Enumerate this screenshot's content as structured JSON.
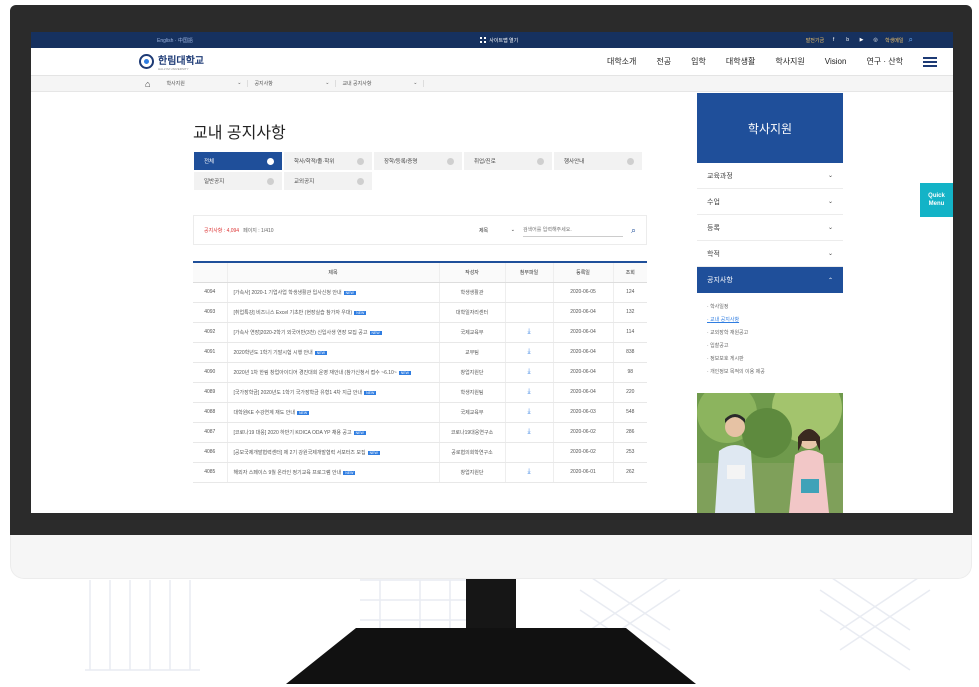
{
  "topbar": {
    "lang": "English · 中国語",
    "sitemap": "사이트맵 열기",
    "quick_label": "발전기금",
    "sns": [
      "f",
      "b",
      "▶",
      "◎"
    ],
    "student_link": "학생메일"
  },
  "header": {
    "logo": "한림대학교",
    "logo_sub": "HALLYM UNIVERSITY",
    "nav": [
      "대학소개",
      "전공",
      "입학",
      "대학생활",
      "학사지원",
      "Vision",
      "연구 · 산학"
    ]
  },
  "breadcrumb": [
    "학사지원",
    "공지사항",
    "교내 공지사항"
  ],
  "page_title": "교내 공지사항",
  "categories": [
    "전체",
    "학사/학적/졸·학위",
    "장학/등록/증명",
    "취업/진로",
    "행사안내",
    "일반공지",
    "교외공지"
  ],
  "search": {
    "count_label": "공지사항 : 4,094",
    "page_label": "페이지 : 1/410",
    "field": "제목",
    "placeholder": "검색어를 입력해주세요."
  },
  "table": {
    "headers": [
      "",
      "제목",
      "작성자",
      "첨부파일",
      "등록일",
      "조회"
    ],
    "new_badge": "NEW",
    "rows": [
      {
        "no": "4094",
        "title": "[가속사] 2020-1 기업사업 학생생활관 입사신청 안내",
        "author": "학생생활관",
        "file": false,
        "date": "2020-06-05",
        "views": "124"
      },
      {
        "no": "4093",
        "title": "[취업특강] 비즈니스 Excel 기초반 (현장실습 참가자 우대)",
        "author": "대학일자리센터",
        "file": false,
        "date": "2020-06-04",
        "views": "132"
      },
      {
        "no": "4092",
        "title": "[가속사 연장]2020-2학기 외국어반(3천) 신입사생 연장 모집 공고",
        "author": "국제교육부",
        "file": true,
        "date": "2020-06-04",
        "views": "114"
      },
      {
        "no": "4091",
        "title": "2020학년도 1학기 기말시험 시행 안내",
        "author": "교무팀",
        "file": true,
        "date": "2020-06-04",
        "views": "838"
      },
      {
        "no": "4090",
        "title": "2020년 1차 한림 창업아이디어 경진대회 운영 재안내 (참가신청서 접수 ~6.10~",
        "author": "창업지원단",
        "file": true,
        "date": "2020-06-04",
        "views": "98"
      },
      {
        "no": "4089",
        "title": "[국가장학금] 2020년도 1학기 국가장학금 유형1 4차 지급 안내",
        "author": "학생지원팀",
        "file": true,
        "date": "2020-06-04",
        "views": "220"
      },
      {
        "no": "4088",
        "title": "대학원KE 수강연계 재도 안내",
        "author": "국제교육부",
        "file": true,
        "date": "2020-06-03",
        "views": "548"
      },
      {
        "no": "4087",
        "title": "[코로나19 대응] 2020 하반기 KOICA ODA YP 채용 공고",
        "author": "코로나19대응연구소",
        "file": true,
        "date": "2020-06-02",
        "views": "286"
      },
      {
        "no": "4086",
        "title": "[공모국제개발협력센터] 제 2기 강원국제개발협력 서포터즈 모집",
        "author": "공로협의회학연구소",
        "file": false,
        "date": "2020-06-02",
        "views": "253"
      },
      {
        "no": "4085",
        "title": "해외자 스페이스 9월 온라인 정기교육 프로그램 안내",
        "author": "창업지원단",
        "file": true,
        "date": "2020-06-01",
        "views": "262"
      }
    ]
  },
  "side": {
    "title": "학사지원",
    "items": [
      "교육과정",
      "수업",
      "등록",
      "학적",
      "공지사항"
    ],
    "sub_items": [
      "학사일정",
      "교내 공지사항",
      "교외장학 재원공고",
      "입찰공고",
      "정보보호 게시판",
      "개인정보 목적의 이용 제공"
    ]
  },
  "quick_menu": "Quick Menu"
}
